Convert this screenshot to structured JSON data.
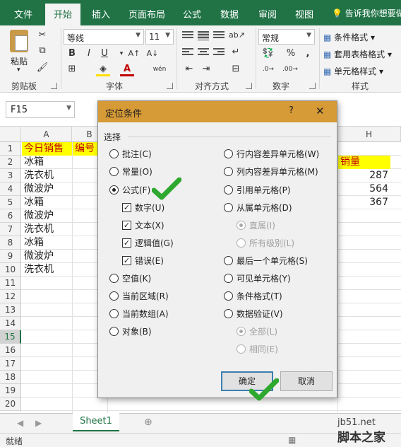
{
  "ribbon_tabs": [
    "文件",
    "开始",
    "插入",
    "页面布局",
    "公式",
    "数据",
    "审阅",
    "视图"
  ],
  "tell_me": "告诉我你想要做",
  "ribbon": {
    "paste_label": "粘贴",
    "clipboard_label": "剪贴板",
    "font_name": "等线",
    "font_size": "11",
    "font_label": "字体",
    "alignment_label": "对齐方式",
    "number_format": "常规",
    "number_label": "数字",
    "styles": [
      "条件格式",
      "套用表格格式",
      "单元格样式"
    ],
    "styles_label": "样式",
    "bold": "B",
    "italic": "I",
    "underline": "U",
    "font_color_glyph": "A",
    "wen_glyph": "wén",
    "percent": "%",
    "comma": ","
  },
  "name_box": "F15",
  "columns": [
    "A",
    "B",
    "H"
  ],
  "rows": [
    "1",
    "2",
    "3",
    "4",
    "5",
    "6",
    "7",
    "8",
    "9",
    "10",
    "11",
    "12",
    "13",
    "14",
    "15",
    "16",
    "17",
    "18",
    "19",
    "20"
  ],
  "selected_row": "15",
  "cells": {
    "a1": "今日销售",
    "b1": "编号",
    "h2": "销量",
    "col_a": [
      "冰箱",
      "洗衣机",
      "微波炉",
      "冰箱",
      "微波炉",
      "洗衣机",
      "冰箱",
      "微波炉",
      "洗衣机"
    ],
    "col_h": [
      "287",
      "564",
      "367"
    ]
  },
  "sheet_tab": "Sheet1",
  "add_sheet": "⊕",
  "status": "就绪",
  "dialog": {
    "title": "定位条件",
    "help": "?",
    "close": "✕",
    "group_label": "选择",
    "left_options": [
      "批注(C)",
      "常量(O)",
      "公式(F)"
    ],
    "formula_sub": [
      "数字(U)",
      "文本(X)",
      "逻辑值(G)",
      "错误(E)"
    ],
    "left_options2": [
      "空值(K)",
      "当前区域(R)",
      "当前数组(A)",
      "对象(B)"
    ],
    "right_options": [
      "行内容差异单元格(W)",
      "列内容差异单元格(M)",
      "引用单元格(P)",
      "从属单元格(D)"
    ],
    "dependents_sub": [
      "直属(I)",
      "所有级别(L)"
    ],
    "right_options2": [
      "最后一个单元格(S)",
      "可见单元格(Y)",
      "条件格式(T)",
      "数据验证(V)"
    ],
    "validation_sub": [
      "全部(L)",
      "相同(E)"
    ],
    "ok": "确定",
    "cancel": "取消"
  },
  "watermark": "jb51.net",
  "watermark_cn": "脚本之家",
  "colors": {
    "ribbon_green": "#217346",
    "dialog_title": "#d69a36",
    "highlight": "#ffff00",
    "highlight_text": "#c00000",
    "tick": "#2ea82e"
  }
}
